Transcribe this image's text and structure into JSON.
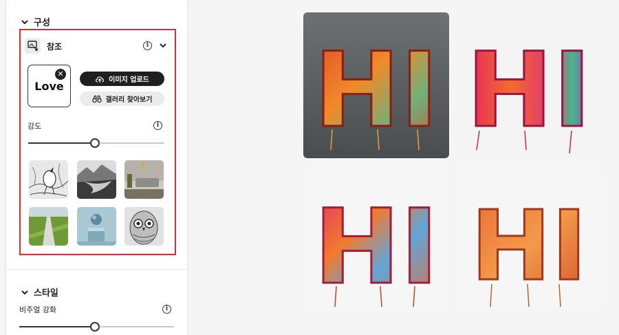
{
  "composition": {
    "title": "구성"
  },
  "reference": {
    "label": "참조",
    "thumbnail_text": "Love",
    "upload_button": "이미지 업로드",
    "gallery_button": "갤러리 찾아보기",
    "strength_label": "강도",
    "strength_value": 0.49
  },
  "style": {
    "title": "스타일",
    "visual_intensity_label": "비주얼 강화",
    "visual_intensity_value": 0.49
  },
  "reference_gallery": [
    {
      "name": "bird-sketch-thumb"
    },
    {
      "name": "mountain-lake-thumb"
    },
    {
      "name": "living-room-thumb"
    },
    {
      "name": "green-road-thumb"
    },
    {
      "name": "blue-sphere-thumb"
    },
    {
      "name": "owl-sketch-thumb"
    }
  ],
  "results": [
    {
      "name": "result-image-1",
      "text": "HI",
      "bg": "#5f6264"
    },
    {
      "name": "result-image-2",
      "text": "HI",
      "bg": "#f4f4f4"
    },
    {
      "name": "result-image-3",
      "text": "HI",
      "bg": "#f6f6f6"
    },
    {
      "name": "result-image-4",
      "text": "HI",
      "bg": "#f6f6f6"
    }
  ],
  "colors": {
    "accent_red": "#e3272c",
    "dark_button": "#1f1f1f"
  }
}
